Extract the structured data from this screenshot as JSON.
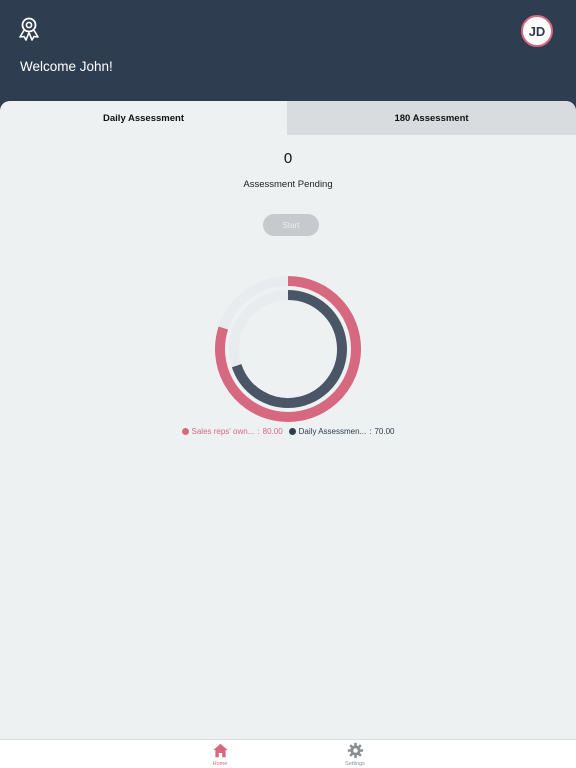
{
  "header": {
    "welcome": "Welcome John!",
    "avatar_initials": "JD",
    "app_icon": "award-ribbon-icon"
  },
  "tabs": [
    {
      "label": "Daily Assessment",
      "active": true
    },
    {
      "label": "180 Assessment",
      "active": false
    }
  ],
  "summary": {
    "pending_count": "0",
    "pending_label": "Assessment Pending",
    "start_label": "Start"
  },
  "chart_data": {
    "type": "pie",
    "series": [
      {
        "name": "Sales reps' own...",
        "value": 80.0,
        "value_label": "80.00",
        "color": "#d6697f"
      },
      {
        "name": "Daily Assessmen...",
        "value": 70.0,
        "value_label": "70.00",
        "color": "#4a5566"
      }
    ],
    "max": 100,
    "legend": "bottom"
  },
  "bottom_nav": {
    "items": [
      {
        "label": "Home",
        "icon": "home-icon",
        "active": true
      },
      {
        "label": "Settings",
        "icon": "gear-icon",
        "active": false
      }
    ]
  },
  "colors": {
    "header_bg": "#2e3d50",
    "accent": "#d6697f",
    "panel_bg": "#eef1f2"
  }
}
